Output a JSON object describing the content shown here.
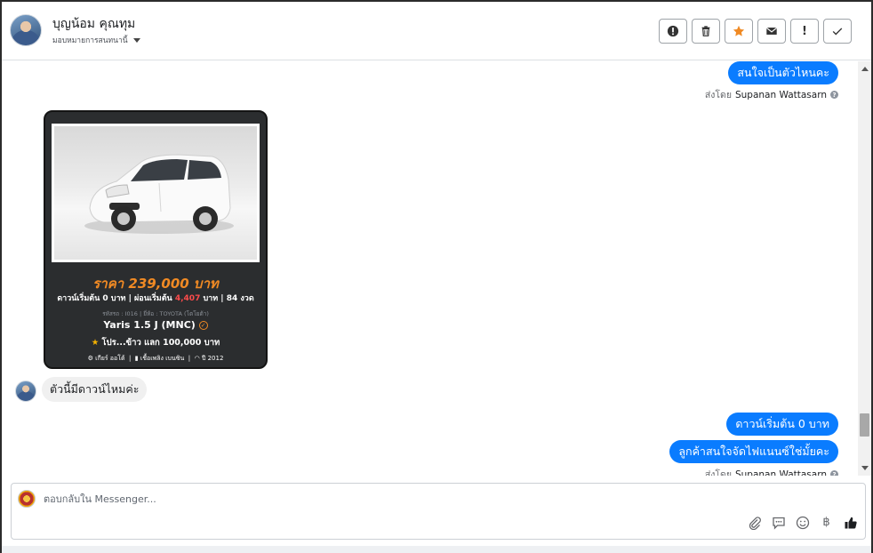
{
  "header": {
    "contact_name": "บุญน้อม คุณทุม",
    "assign_label": "มอบหมายการสนทนานี้",
    "toolbar": [
      {
        "name": "spam-button",
        "icon": "alert-circle-icon"
      },
      {
        "name": "delete-button",
        "icon": "trash-icon"
      },
      {
        "name": "star-button",
        "icon": "star-icon"
      },
      {
        "name": "mark-unread-button",
        "icon": "envelope-icon"
      },
      {
        "name": "follow-up-button",
        "icon": "exclamation-icon"
      },
      {
        "name": "done-button",
        "icon": "check-icon"
      }
    ],
    "toolbar_glyphs": {
      "exclamation": "!"
    }
  },
  "messages": {
    "out_1": "สนใจเป็นตัวไหนคะ",
    "sent_by_prefix": "ส่งโดย",
    "agent_name": "Supanan Wattasarn",
    "card": {
      "price": "ราคา 239,000 บาท",
      "down_prefix": "ดาวน์เริ่มต้น 0 บาท | ผ่อนเริ่มต้น",
      "installment": "4,407",
      "down_suffix": "บาท | 84 งวด",
      "meta": "รหัสรถ : I016 | ยี่ห้อ : TOYOTA (โตโยต้า)",
      "model": "Yaris 1.5 J (MNC)",
      "promo": "โปร...ข้าว แลก 100,000 บาท",
      "foot_gear": "เกียร์ ออโต้",
      "foot_fuel": "เชื้อเพลิง เบนซิน",
      "foot_year": "ปี 2012"
    },
    "in_1": "ตัวนี้มีดาวน์ไหมค่ะ",
    "out_2": "ดาวน์เริ่มต้น 0 บาท",
    "out_3": "ลูกค้าสนใจจัดไฟแนนซ์ใช่มั้ยคะ"
  },
  "composer": {
    "placeholder": "ตอบกลับใน Messenger...",
    "currency_symbol": "฿"
  },
  "colors": {
    "bubble_out": "#0a7cff",
    "bubble_in": "#f0f0f0",
    "price_orange": "#f08a24",
    "installment_red": "#ff4b4b",
    "star_active": "#f08a24"
  }
}
